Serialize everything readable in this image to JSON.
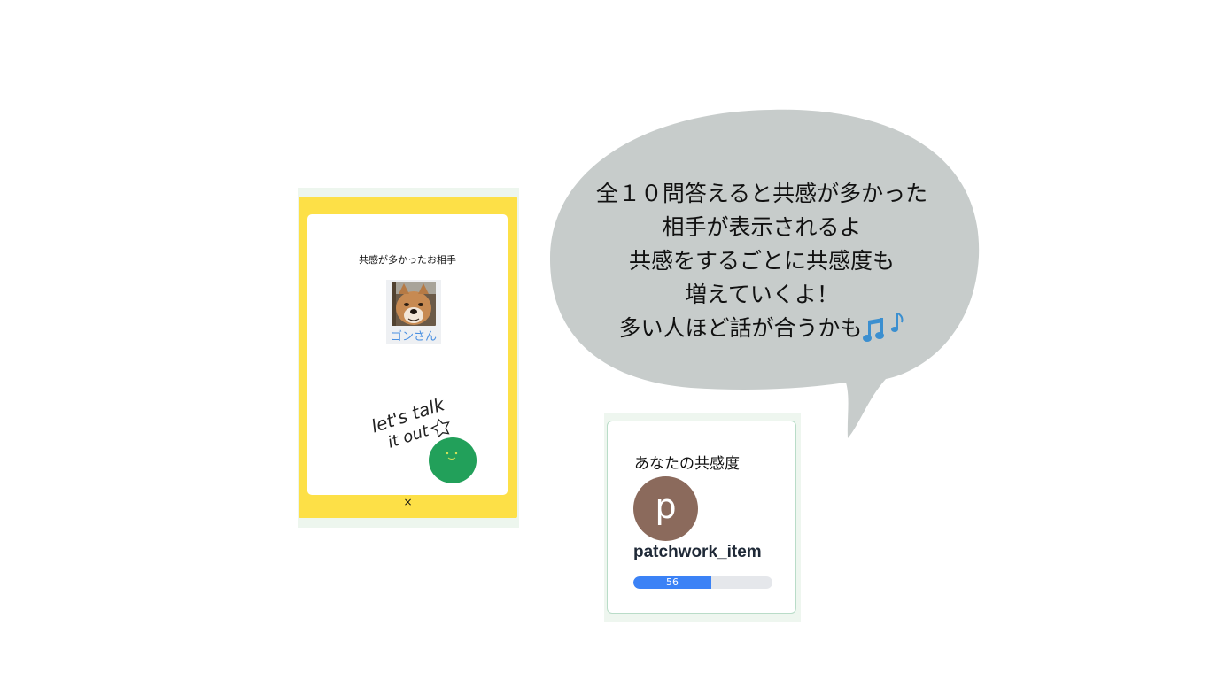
{
  "modal": {
    "title": "共感が多かったお相手",
    "partner_name": "ゴンさん",
    "doodle_text_line1": "let's talk",
    "doodle_text_line2": "it out",
    "close_label": "×"
  },
  "bubble": {
    "lines": [
      "全１０問答えると共感が多かった",
      "相手が表示されるよ",
      "共感をするごとに共感度も",
      "増えていくよ！",
      "多い人ほど話が合うかも"
    ],
    "trailing_icon": "music-notes-icon"
  },
  "card": {
    "title": "あなたの共感度",
    "avatar_letter": "p",
    "username": "patchwork_item",
    "score": 56,
    "score_label": "56",
    "score_max": 100
  },
  "colors": {
    "modal_bg": "#fde047",
    "bubble_bg": "#c7cccb",
    "avatar_bg": "#8b6a5c",
    "progress_fill": "#3b82f6",
    "partner_name": "#4a90e2",
    "blob": "#22a05a"
  }
}
